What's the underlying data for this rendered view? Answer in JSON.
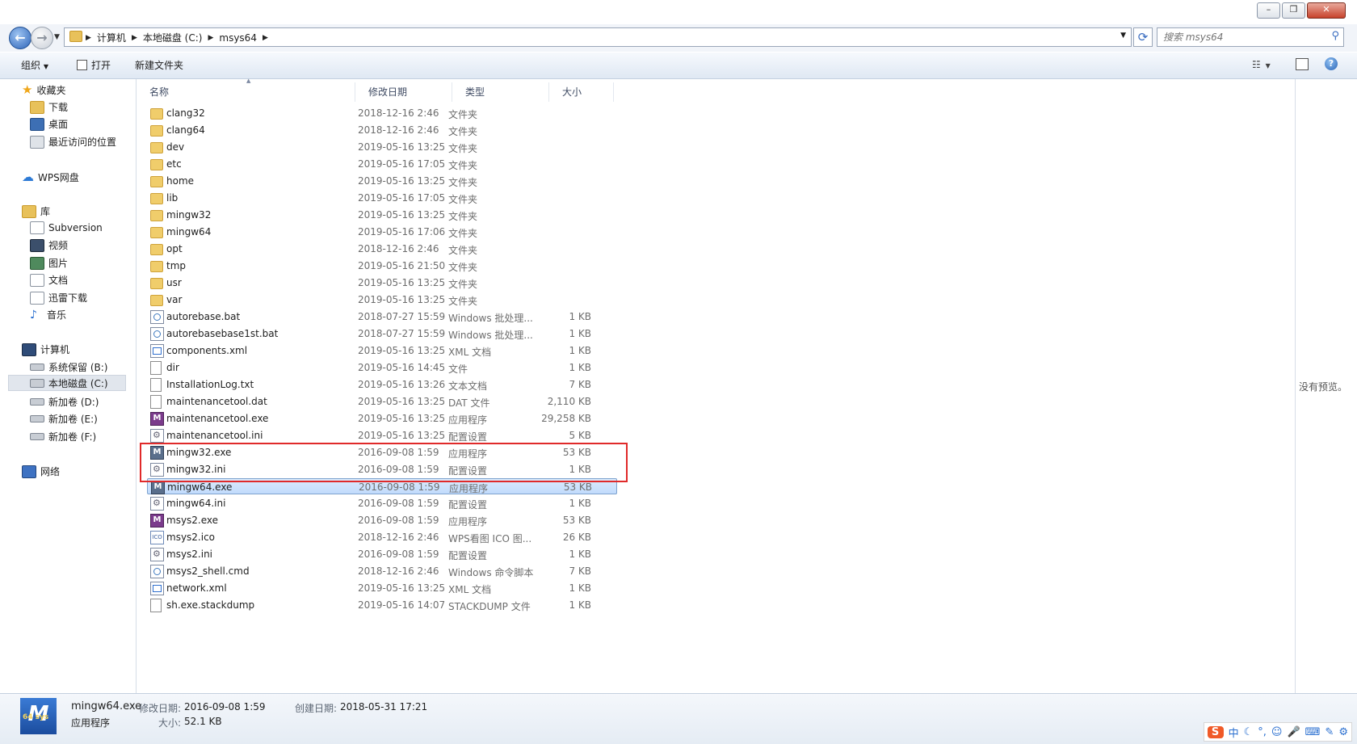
{
  "window": {
    "caption_buttons": [
      "–",
      "❐",
      "✕"
    ]
  },
  "address": {
    "crumbs": [
      "计算机",
      "本地磁盘 (C:)",
      "msys64"
    ],
    "search_placeholder": "搜索 msys64"
  },
  "toolbar": {
    "organize": "组织",
    "open": "打开",
    "new_folder": "新建文件夹"
  },
  "nav": {
    "favorites": "收藏夹",
    "downloads": "下载",
    "desktop": "桌面",
    "recent": "最近访问的位置",
    "wps": "WPS网盘",
    "libraries": "库",
    "subversion": "Subversion",
    "videos": "视频",
    "pictures": "图片",
    "documents": "文档",
    "xunlei": "迅雷下载",
    "music": "音乐",
    "computer": "计算机",
    "drive_b": "系统保留 (B:)",
    "drive_c": "本地磁盘 (C:)",
    "drive_d": "新加卷 (D:)",
    "drive_e": "新加卷 (E:)",
    "drive_f": "新加卷 (F:)",
    "network": "网络"
  },
  "columns": {
    "name": "名称",
    "date": "修改日期",
    "type": "类型",
    "size": "大小"
  },
  "files": [
    {
      "name": "clang32",
      "date": "2018-12-16 2:46",
      "type": "文件夹",
      "size": "",
      "icon": "folder"
    },
    {
      "name": "clang64",
      "date": "2018-12-16 2:46",
      "type": "文件夹",
      "size": "",
      "icon": "folder"
    },
    {
      "name": "dev",
      "date": "2019-05-16 13:25",
      "type": "文件夹",
      "size": "",
      "icon": "folder"
    },
    {
      "name": "etc",
      "date": "2019-05-16 17:05",
      "type": "文件夹",
      "size": "",
      "icon": "folder"
    },
    {
      "name": "home",
      "date": "2019-05-16 13:25",
      "type": "文件夹",
      "size": "",
      "icon": "folder"
    },
    {
      "name": "lib",
      "date": "2019-05-16 17:05",
      "type": "文件夹",
      "size": "",
      "icon": "folder"
    },
    {
      "name": "mingw32",
      "date": "2019-05-16 13:25",
      "type": "文件夹",
      "size": "",
      "icon": "folder"
    },
    {
      "name": "mingw64",
      "date": "2019-05-16 17:06",
      "type": "文件夹",
      "size": "",
      "icon": "folder"
    },
    {
      "name": "opt",
      "date": "2018-12-16 2:46",
      "type": "文件夹",
      "size": "",
      "icon": "folder"
    },
    {
      "name": "tmp",
      "date": "2019-05-16 21:50",
      "type": "文件夹",
      "size": "",
      "icon": "folder"
    },
    {
      "name": "usr",
      "date": "2019-05-16 13:25",
      "type": "文件夹",
      "size": "",
      "icon": "folder"
    },
    {
      "name": "var",
      "date": "2019-05-16 13:25",
      "type": "文件夹",
      "size": "",
      "icon": "folder"
    },
    {
      "name": "autorebase.bat",
      "date": "2018-07-27 15:59",
      "type": "Windows 批处理...",
      "size": "1 KB",
      "icon": "bat"
    },
    {
      "name": "autorebasebase1st.bat",
      "date": "2018-07-27 15:59",
      "type": "Windows 批处理...",
      "size": "1 KB",
      "icon": "bat"
    },
    {
      "name": "components.xml",
      "date": "2019-05-16 13:25",
      "type": "XML 文档",
      "size": "1 KB",
      "icon": "xml"
    },
    {
      "name": "dir",
      "date": "2019-05-16 14:45",
      "type": "文件",
      "size": "1 KB",
      "icon": "doc"
    },
    {
      "name": "InstallationLog.txt",
      "date": "2019-05-16 13:26",
      "type": "文本文档",
      "size": "7 KB",
      "icon": "doc"
    },
    {
      "name": "maintenancetool.dat",
      "date": "2019-05-16 13:25",
      "type": "DAT 文件",
      "size": "2,110 KB",
      "icon": "doc"
    },
    {
      "name": "maintenancetool.exe",
      "date": "2019-05-16 13:25",
      "type": "应用程序",
      "size": "29,258 KB",
      "icon": "exe-msys"
    },
    {
      "name": "maintenancetool.ini",
      "date": "2019-05-16 13:25",
      "type": "配置设置",
      "size": "5 KB",
      "icon": "ini"
    },
    {
      "name": "mingw32.exe",
      "date": "2016-09-08 1:59",
      "type": "应用程序",
      "size": "53 KB",
      "icon": "exe"
    },
    {
      "name": "mingw32.ini",
      "date": "2016-09-08 1:59",
      "type": "配置设置",
      "size": "1 KB",
      "icon": "ini"
    },
    {
      "name": "mingw64.exe",
      "date": "2016-09-08 1:59",
      "type": "应用程序",
      "size": "53 KB",
      "icon": "exe",
      "selected": true
    },
    {
      "name": "mingw64.ini",
      "date": "2016-09-08 1:59",
      "type": "配置设置",
      "size": "1 KB",
      "icon": "ini"
    },
    {
      "name": "msys2.exe",
      "date": "2016-09-08 1:59",
      "type": "应用程序",
      "size": "53 KB",
      "icon": "exe-msys"
    },
    {
      "name": "msys2.ico",
      "date": "2018-12-16 2:46",
      "type": "WPS看图 ICO 图...",
      "size": "26 KB",
      "icon": "ico"
    },
    {
      "name": "msys2.ini",
      "date": "2016-09-08 1:59",
      "type": "配置设置",
      "size": "1 KB",
      "icon": "ini"
    },
    {
      "name": "msys2_shell.cmd",
      "date": "2018-12-16 2:46",
      "type": "Windows 命令脚本",
      "size": "7 KB",
      "icon": "bat"
    },
    {
      "name": "network.xml",
      "date": "2019-05-16 13:25",
      "type": "XML 文档",
      "size": "1 KB",
      "icon": "xml"
    },
    {
      "name": "sh.exe.stackdump",
      "date": "2019-05-16 14:07",
      "type": "STACKDUMP 文件",
      "size": "1 KB",
      "icon": "doc"
    }
  ],
  "preview": {
    "empty_text": "没有预览。"
  },
  "details": {
    "file_name": "mingw64.exe",
    "file_type": "应用程序",
    "modified_label": "修改日期:",
    "modified_value": "2016-09-08 1:59",
    "created_label": "创建日期:",
    "created_value": "2018-05-31 17:21",
    "size_label": "大小:",
    "size_value": "52.1 KB",
    "icon_text": "M",
    "icon_sub": "64 sys"
  },
  "ime": {
    "logo": "S",
    "lang": "中",
    "items": [
      "☾",
      "°,",
      "☺",
      "🎤",
      "⌨",
      "✎",
      "⚙"
    ]
  },
  "colors": {
    "selection": "#c1dbfc",
    "highlight_box": "#e02a2a",
    "toolbar": "#dfe8f3"
  }
}
